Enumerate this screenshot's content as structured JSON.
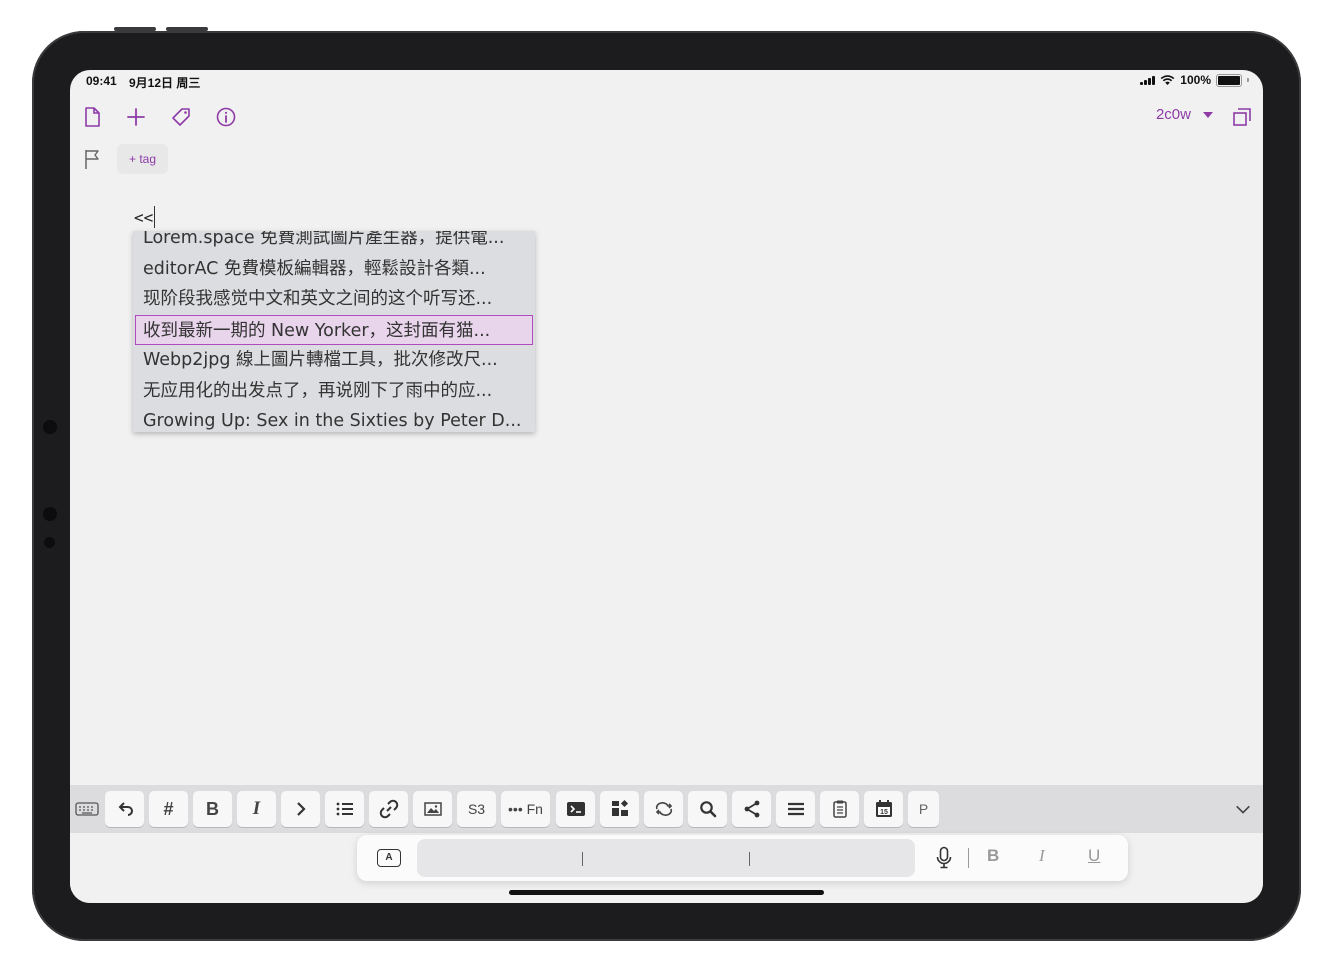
{
  "status_bar": {
    "time": "09:41",
    "date": "9月12日 周三",
    "battery": "100%"
  },
  "toolbar": {
    "icons": [
      "new-document-icon",
      "plus-icon",
      "tag-icon",
      "info-icon"
    ],
    "document_selector": "2c0w",
    "right_icon": "external-window-icon"
  },
  "tags": {
    "flag_icon": "flag-icon",
    "add_tag_label": "+ tag"
  },
  "editor": {
    "text": "<<"
  },
  "autocomplete": {
    "items": [
      "Lorem.space 免費測試圖片產生器，提供電...",
      "editorAC 免費模板編輯器，輕鬆設計各類...",
      "现阶段我感觉中文和英文之间的这个听写还...",
      "收到最新一期的 New Yorker，这封面有猫...",
      "Webp2jpg 線上圖片轉檔工具，批次修改尺...",
      "无应用化的出发点了，再说刚下了雨中的应...",
      "Growing Up: Sex in the Sixties by Peter D..."
    ],
    "selected_index": 3
  },
  "keyboard_toolbar": {
    "hash": "#",
    "bold": "B",
    "italic": "I",
    "s3": "S3",
    "fn": "••• Fn",
    "p": "P"
  },
  "input_bar": {
    "a_label": "A",
    "bold": "B",
    "italic": "I",
    "underline": "U"
  },
  "colors": {
    "accent": "#8e3ba8",
    "selection_border": "#b04bbd",
    "selection_fill": "#e8d4eb"
  }
}
